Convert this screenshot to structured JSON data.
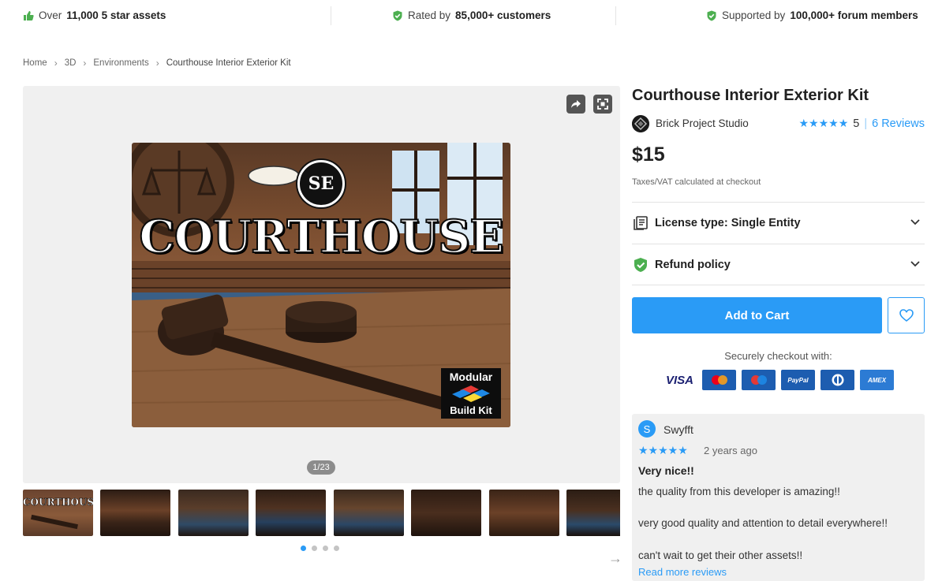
{
  "trust_bar": {
    "assets": {
      "prefix": "Over",
      "bold": "11,000 5 star assets",
      "icon": "thumbs-up-icon",
      "color": "#4caf50"
    },
    "rated": {
      "prefix": "Rated by",
      "bold": "85,000+ customers",
      "icon": "check-circle-icon",
      "color": "#4caf50"
    },
    "supported": {
      "prefix": "Supported by",
      "bold": "100,000+ forum members",
      "icon": "check-circle-icon",
      "color": "#4caf50"
    }
  },
  "breadcrumb": [
    "Home",
    "3D",
    "Environments",
    "Courthouse Interior Exterior Kit"
  ],
  "gallery": {
    "hero_title": "COURTHOUSE",
    "hero_logo": "SE",
    "badge_line1": "Modular",
    "badge_line2": "Build Kit",
    "counter": "1/23",
    "thumb_title": "COURTHOUSE",
    "thumb_count": 8,
    "dots": 4,
    "active_dot": 0
  },
  "product": {
    "title": "Courthouse Interior Exterior Kit",
    "publisher": "Brick Project Studio",
    "rating_stars": "★★★★★",
    "rating_value": "5",
    "rating_sep": "|",
    "reviews_link": "6 Reviews",
    "price": "$15",
    "tax_note": "Taxes/VAT calculated at checkout"
  },
  "accordion": {
    "license_label": "License type: Single Entity",
    "refund_label": "Refund policy"
  },
  "actions": {
    "add_to_cart": "Add to Cart",
    "secure_checkout": "Securely checkout with:"
  },
  "payments": [
    {
      "name": "VISA",
      "key": "visa"
    },
    {
      "name": "MasterCard",
      "key": "mc"
    },
    {
      "name": "Maestro",
      "key": "maestro"
    },
    {
      "name": "PayPal",
      "key": "paypal"
    },
    {
      "name": "Diners",
      "key": "diners"
    },
    {
      "name": "AMEX",
      "key": "amex"
    }
  ],
  "review": {
    "avatar_letter": "S",
    "author": "Swyfft",
    "stars": "★★★★★",
    "date": "2 years ago",
    "title": "Very nice!!",
    "line1": "the quality from this developer is amazing!!",
    "line2": "very good quality and attention to detail everywhere!!",
    "line3": "can't wait to get their other assets!!",
    "read_more": "Read more reviews"
  },
  "colors": {
    "accent": "#2a9bf6",
    "success": "#4caf50",
    "text": "#212121"
  }
}
